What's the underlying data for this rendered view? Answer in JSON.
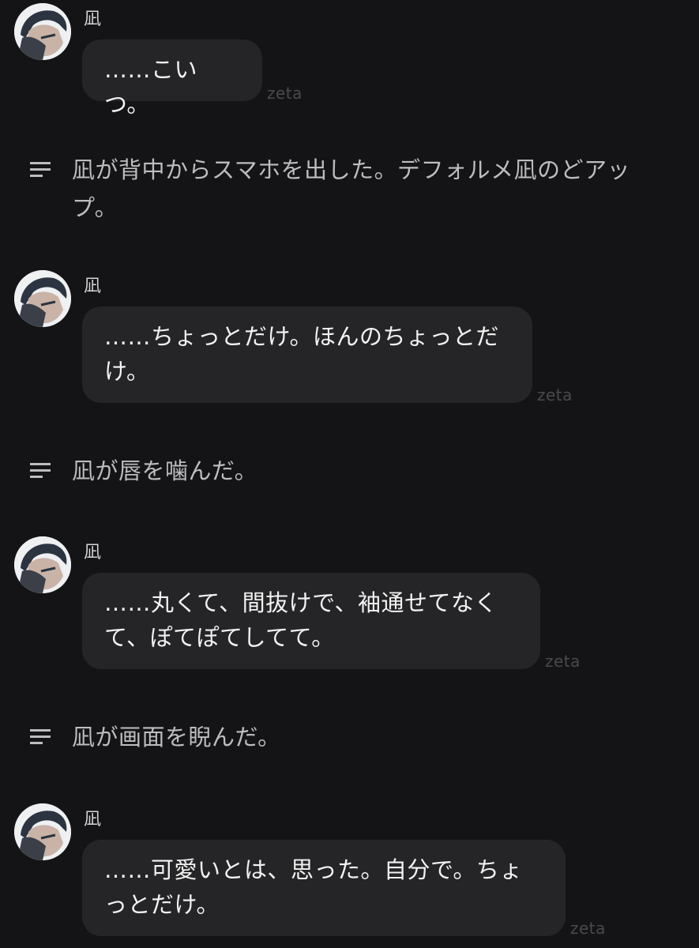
{
  "messages": [
    {
      "type": "char",
      "name": "凪",
      "text": "……こいつ。",
      "brand": "zeta"
    },
    {
      "type": "narration",
      "text": "凪が背中からスマホを出した。デフォルメ凪のどアップ。"
    },
    {
      "type": "char",
      "name": "凪",
      "text": "……ちょっとだけ。ほんのちょっとだけ。",
      "brand": "zeta"
    },
    {
      "type": "narration",
      "text": "凪が唇を噛んだ。"
    },
    {
      "type": "char",
      "name": "凪",
      "text": "……丸くて、間抜けで、袖通せてなくて、ぽてぽてしてて。",
      "brand": "zeta"
    },
    {
      "type": "narration",
      "text": "凪が画面を睨んだ。"
    },
    {
      "type": "char",
      "name": "凪",
      "text": "……可愛いとは、思った。自分で。ちょっとだけ。",
      "brand": "zeta"
    }
  ],
  "icons": {
    "avatar": "character-avatar",
    "narration": "menu-lines-icon"
  },
  "colors": {
    "background": "#141416",
    "bubble": "#252527",
    "text": "#f2f2f2",
    "narration": "#bdbdc0",
    "brand": "#4a4a4e"
  }
}
